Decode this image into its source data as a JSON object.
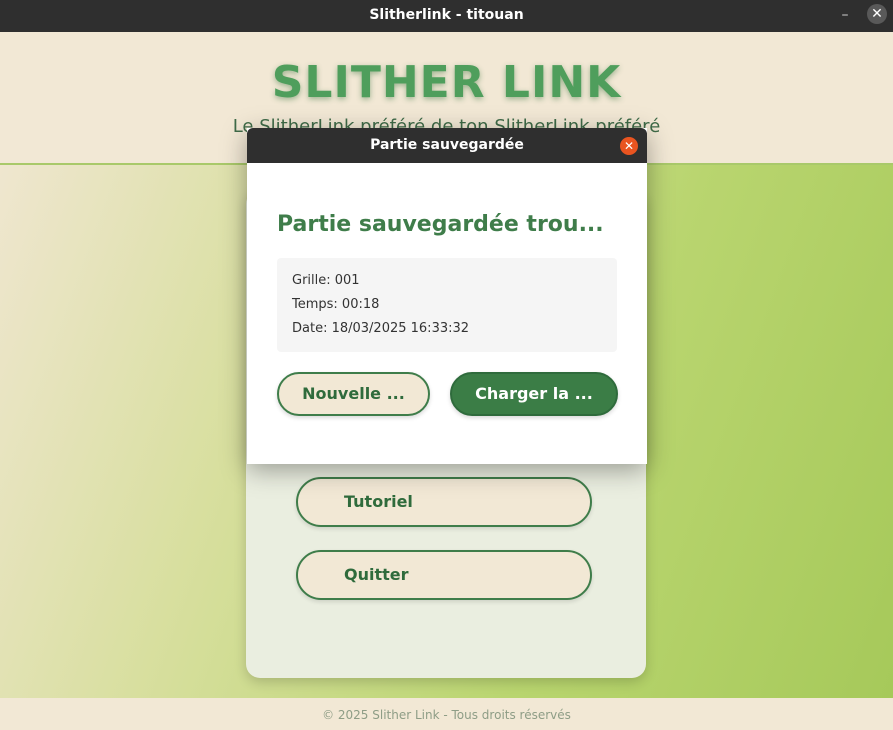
{
  "window": {
    "title": "Slitherlink - titouan",
    "minimize_glyph": "–",
    "close_glyph": "✕"
  },
  "header": {
    "title": "SLITHER LINK",
    "subtitle": "Le SlitherLink préféré de ton SlitherLink préféré"
  },
  "menu": {
    "buttons": [
      {
        "label": "Tutoriel"
      },
      {
        "label": "Quitter"
      }
    ]
  },
  "footer": {
    "text": "© 2025 Slither Link - Tous droits réservés"
  },
  "dialog": {
    "title": "Partie sauvegardée",
    "close_glyph": "✕",
    "heading": "Partie sauvegardée trou...",
    "info": {
      "grid": "Grille: 001",
      "time": "Temps: 00:18",
      "date": "Date: 18/03/2025 16:33:32"
    },
    "new_label": "Nouvelle ...",
    "load_label": "Charger la ..."
  },
  "colors": {
    "accent_green": "#3b7d46",
    "cream": "#f2e8d5",
    "lime": "#a6c95a",
    "dialog_close": "#e95420"
  }
}
